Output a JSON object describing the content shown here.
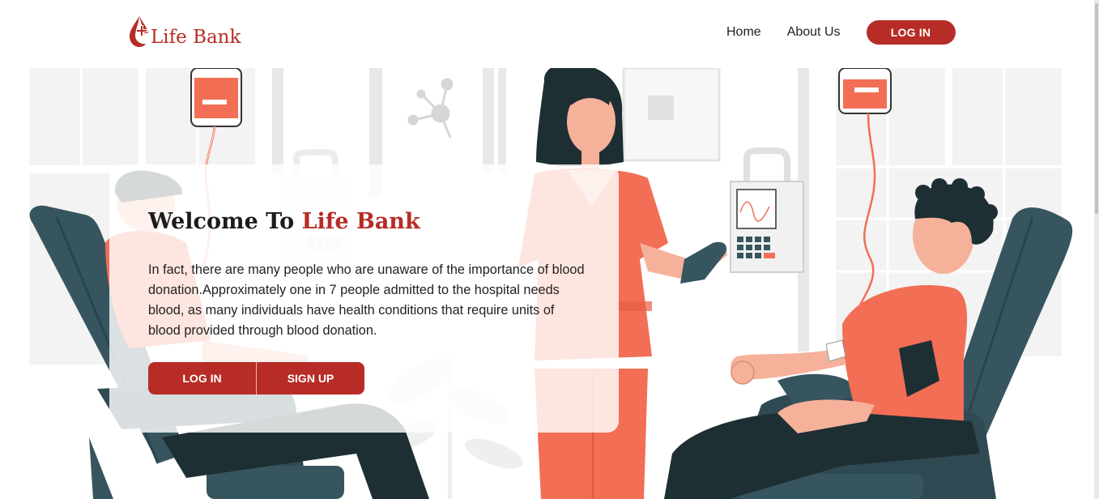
{
  "brand": {
    "name": "Life Bank",
    "logo_icon": "blood-drop-cross-icon"
  },
  "nav": {
    "home": "Home",
    "about": "About Us",
    "login": "LOG IN"
  },
  "hero": {
    "title_prefix": "Welcome To ",
    "title_brand": "Life Bank",
    "description": "In fact, there are many people who are unaware of the importance of blood donation.Approximately one in 7 people admitted to the hospital needs blood, as many individuals have health conditions that require units of blood provided through blood donation.",
    "login_button": "LOG IN",
    "signup_button": "SIGN UP",
    "illustration": "blood-donation-illustration"
  },
  "colors": {
    "accent": "#b72c26",
    "coral": "#f26e55",
    "dark_teal": "#37555f",
    "hair": "#1e2f33"
  }
}
